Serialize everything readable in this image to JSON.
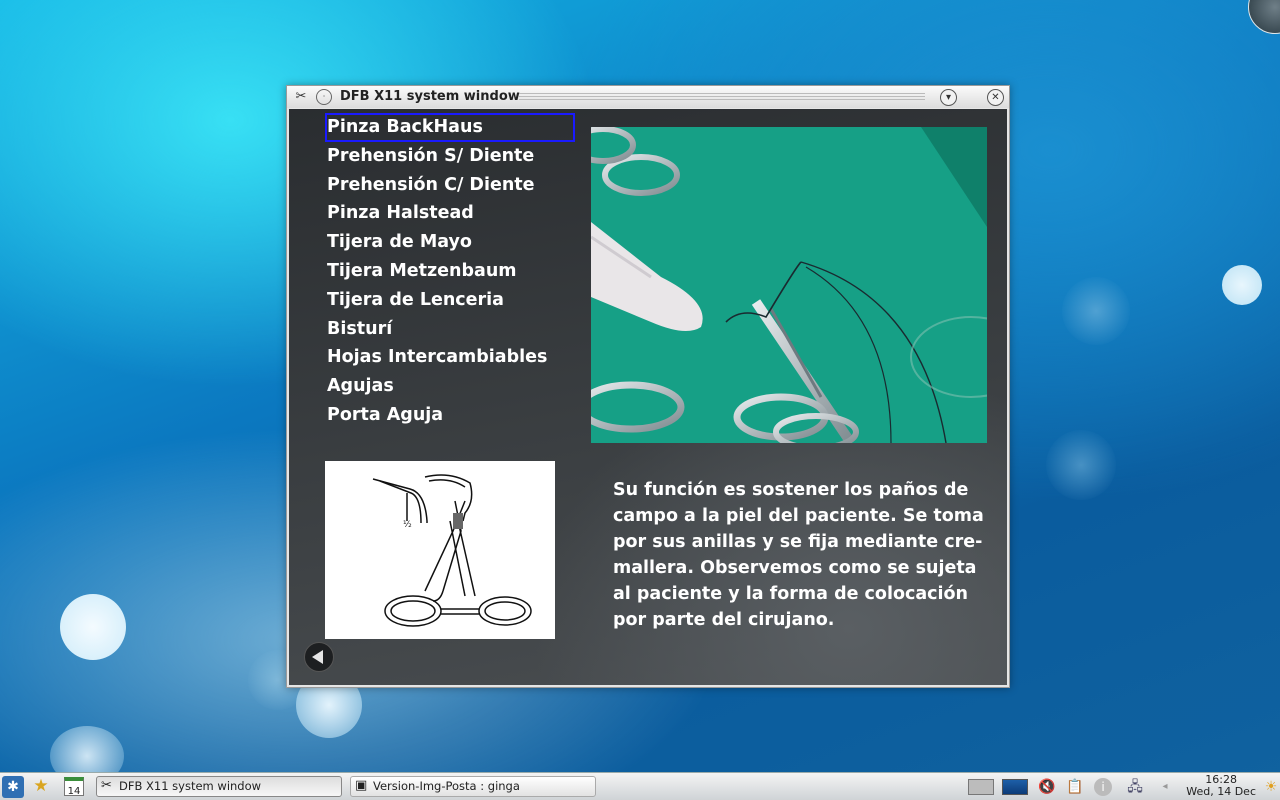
{
  "window": {
    "title": "DFB X11 system window",
    "icons": [
      "app-icon",
      "pin-icon",
      "minimize-icon",
      "close-icon"
    ]
  },
  "menu": {
    "selected_index": 0,
    "items": [
      {
        "label": "Pinza BackHaus"
      },
      {
        "label": "Prehensión S/ Diente"
      },
      {
        "label": "Prehensión C/ Diente"
      },
      {
        "label": "Pinza Halstead"
      },
      {
        "label": "Tijera de Mayo"
      },
      {
        "label": "Tijera Metzenbaum"
      },
      {
        "label": "Tijera de Lenceria"
      },
      {
        "label": "Bisturí"
      },
      {
        "label": "Hojas Intercambiables"
      },
      {
        "label": "Agujas"
      },
      {
        "label": "Porta Aguja"
      }
    ]
  },
  "description": "Su función es sostener los paños de\ncampo a la piel del paciente. Se toma\npor sus anillas y se fija mediante cre-\nmallera. Observemos como se sujeta\nal paciente y la forma de colocación\npor parte del cirujano.",
  "back_button_icon": "back-arrow-icon",
  "taskbar": {
    "tasks": [
      {
        "label": "DFB X11 system window",
        "icon": "app-icon",
        "active": true
      },
      {
        "label": "Version-Img-Posta : ginga",
        "icon": "terminal-icon",
        "active": false
      }
    ],
    "calendar_day": "14",
    "clock_time": "16:28",
    "clock_date": "Wed, 14 Dec"
  },
  "colors": {
    "selection_outline": "#1a1aff",
    "content_bg": "#33373a",
    "photo_green": "#15967f"
  }
}
